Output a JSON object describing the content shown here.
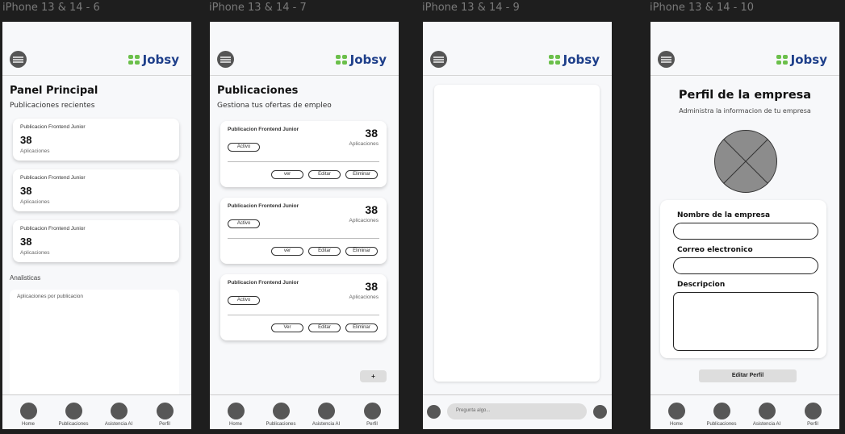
{
  "frames": [
    {
      "title": "iPhone 13 & 14 - 6",
      "page_title": "Panel Principal",
      "subtitle": "Publicaciones recientes",
      "cards": [
        {
          "name": "Publicacion Frontend Junior",
          "count": "38",
          "label": "Aplicaciones"
        },
        {
          "name": "Publicacion Frontend Junior",
          "count": "38",
          "label": "Aplicaciones"
        },
        {
          "name": "Publicacion Frontend Junior",
          "count": "38",
          "label": "Aplicaciones"
        }
      ],
      "analytics_title": "Analisticas",
      "analytics_card_label": "Aplicaciones por publicacion"
    },
    {
      "title": "iPhone 13 & 14 - 7",
      "page_title": "Publicaciones",
      "subtitle": "Gestiona tus ofertas de empleo",
      "jobs": [
        {
          "name": "Publicacion Frontend Junior",
          "status": "Activo",
          "count": "38",
          "label": "Aplicaciones",
          "view": "ver",
          "edit": "Editar",
          "delete": "Eliminar"
        },
        {
          "name": "Publicacion Frontend Junior",
          "status": "Activo",
          "count": "38",
          "label": "Aplicaciones",
          "view": "ver",
          "edit": "Editar",
          "delete": "Eliminar"
        },
        {
          "name": "Publicacion Frontend Junior",
          "status": "Activo",
          "count": "38",
          "label": "Aplicaciones",
          "view": "Ver",
          "edit": "Editar",
          "delete": "Eliminar"
        }
      ],
      "add_label": "+"
    },
    {
      "title": "iPhone 13 & 14 - 9",
      "chat_placeholder": "Pregunta algo..."
    },
    {
      "title": "iPhone 13 & 14 - 10",
      "page_title": "Perfil de la empresa",
      "subtitle": "Administra la informacion de tu empresa",
      "fields": [
        "Nombre de la empresa",
        "Correo electronico",
        "Descripcion"
      ],
      "edit_button": "Editar Perfil"
    }
  ],
  "brand": {
    "name": "Jobsy",
    "text_color": "#1e3f8a",
    "mark_color": "#6bbf4a"
  },
  "nav": [
    "Home",
    "Publicaciones",
    "Asistencia AI",
    "Perfil"
  ]
}
